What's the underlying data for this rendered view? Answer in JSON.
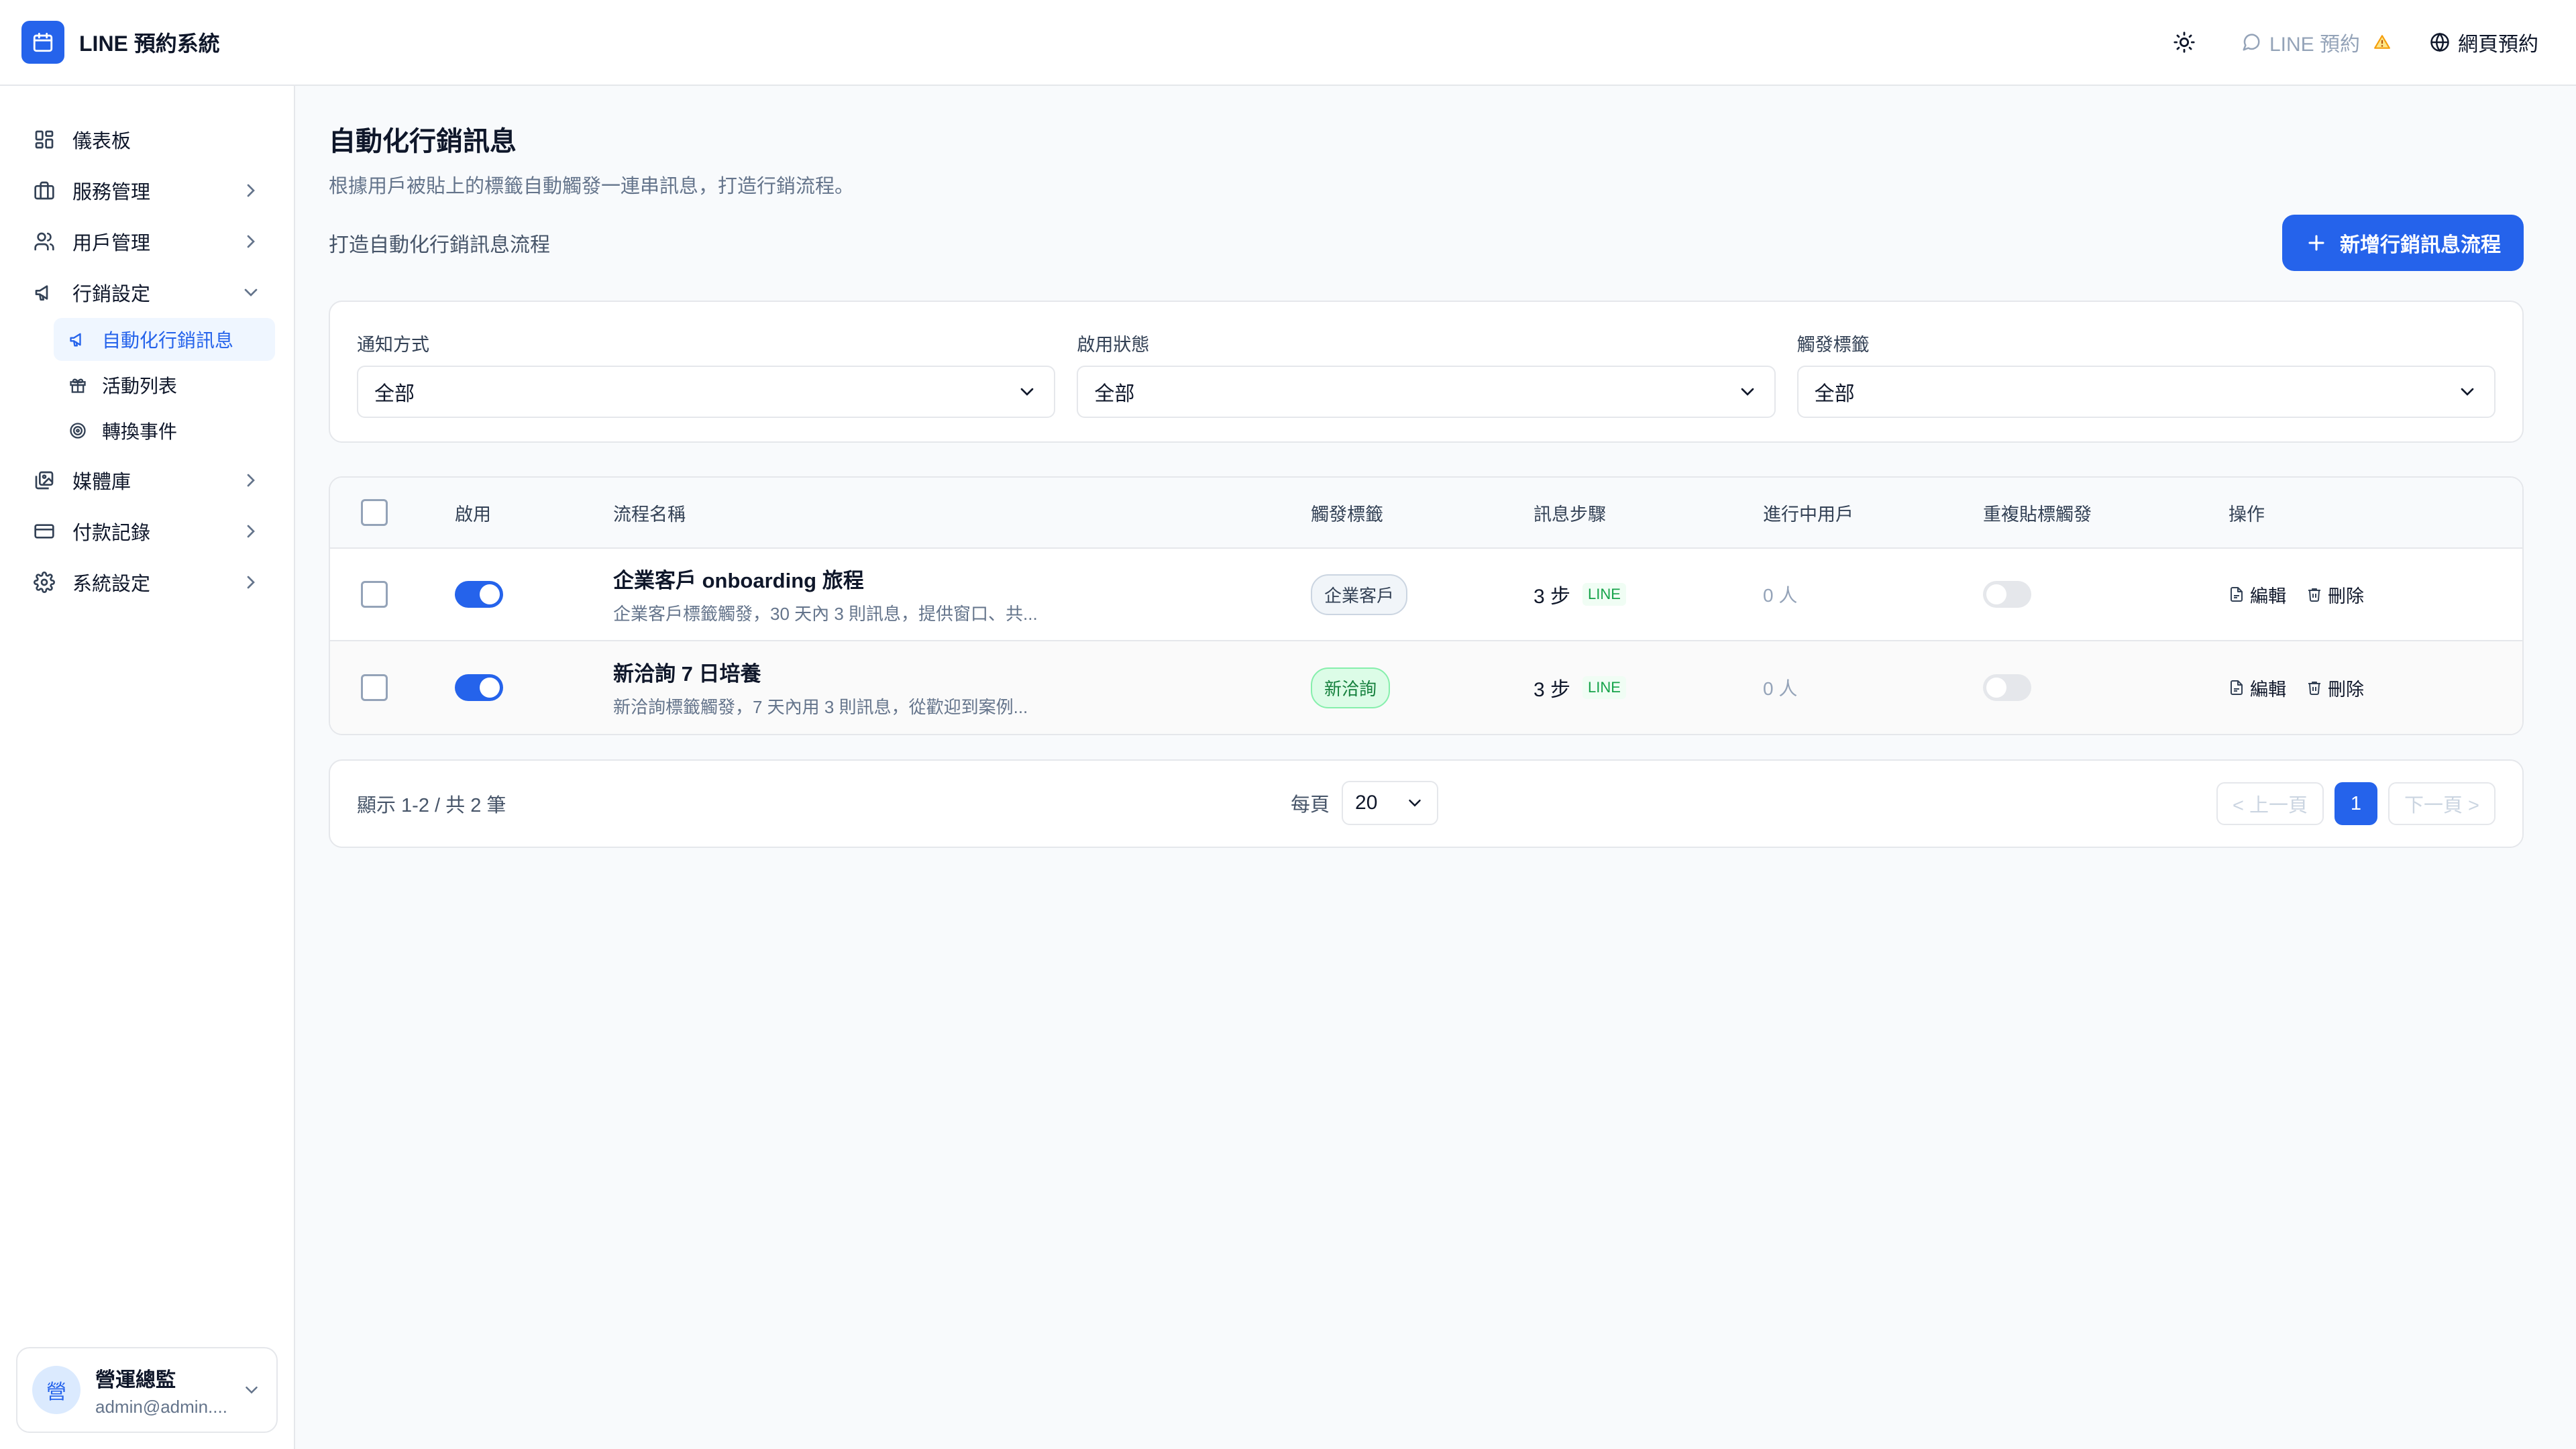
{
  "app": {
    "title": "LINE 預約系統"
  },
  "header": {
    "line_link": "LINE 預約",
    "web_link": "網頁預約"
  },
  "sidebar": {
    "items": [
      {
        "label": "儀表板"
      },
      {
        "label": "服務管理"
      },
      {
        "label": "用戶管理"
      },
      {
        "label": "行銷設定"
      },
      {
        "label": "媒體庫"
      },
      {
        "label": "付款記錄"
      },
      {
        "label": "系統設定"
      }
    ],
    "marketing_sub": [
      {
        "label": "自動化行銷訊息"
      },
      {
        "label": "活動列表"
      },
      {
        "label": "轉換事件"
      }
    ]
  },
  "user": {
    "avatar": "營",
    "name": "營運總監",
    "email": "admin@admin...."
  },
  "page": {
    "title": "自動化行銷訊息",
    "subtitle": "根據用戶被貼上的標籤自動觸發一連串訊息，打造行銷流程。",
    "toolbar_text": "打造自動化行銷訊息流程",
    "add_button": "新增行銷訊息流程"
  },
  "filters": [
    {
      "label": "通知方式",
      "value": "全部"
    },
    {
      "label": "啟用狀態",
      "value": "全部"
    },
    {
      "label": "觸發標籤",
      "value": "全部"
    }
  ],
  "table": {
    "headers": [
      "啟用",
      "流程名稱",
      "觸發標籤",
      "訊息步驟",
      "進行中用戶",
      "重複貼標觸發",
      "操作"
    ],
    "rows": [
      {
        "enabled": true,
        "name": "企業客戶 onboarding 旅程",
        "desc": "企業客戶標籤觸發，30 天內 3 則訊息，提供窗口、共...",
        "tag": "企業客戶",
        "steps": "3 步",
        "channel": "LINE",
        "active_users": "0 人",
        "repeat_trigger": false,
        "edit": "編輯",
        "delete": "刪除"
      },
      {
        "enabled": true,
        "name": "新洽詢 7 日培養",
        "desc": "新洽詢標籤觸發，7 天內用 3 則訊息，從歡迎到案例...",
        "tag": "新洽詢",
        "steps": "3 步",
        "channel": "LINE",
        "active_users": "0 人",
        "repeat_trigger": false,
        "edit": "編輯",
        "delete": "刪除"
      }
    ]
  },
  "pagination": {
    "info": "顯示 1-2 / 共 2 筆",
    "per_page_label": "每頁",
    "per_page_value": "20",
    "prev": "< 上一頁",
    "current": "1",
    "next": "下一頁 >"
  },
  "colors": {
    "accent": "#2563eb",
    "warning": "#f59e0b",
    "success": "#16a34a"
  }
}
